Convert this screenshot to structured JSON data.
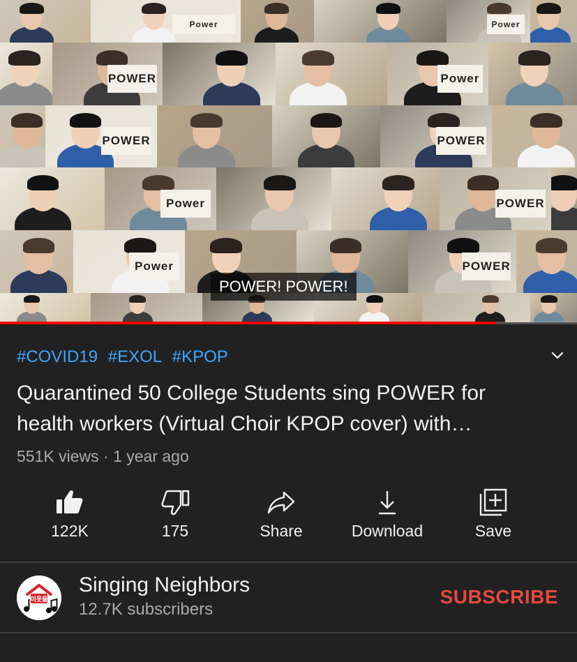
{
  "video": {
    "caption": "POWER! POWER!",
    "progress_percent": 86,
    "tile_signs": [
      "Power",
      "Power",
      "POWER",
      "Power",
      "POWER",
      "POWER",
      "Power",
      "POWER",
      "Power",
      "POWER"
    ]
  },
  "hashtags": [
    "#COVID19",
    "#EXOL",
    "#KPOP"
  ],
  "title": "Quarantined 50 College Students sing POWER for health workers (Virtual Choir KPOP cover) with…",
  "meta": {
    "views": "551K views",
    "separator": " · ",
    "age": "1 year ago"
  },
  "actions": {
    "like": "122K",
    "dislike": "175",
    "share": "Share",
    "download": "Download",
    "save": "Save"
  },
  "channel": {
    "name": "Singing Neighbors",
    "subscribers": "12.7K subscribers",
    "subscribe_label": "SUBSCRIBE",
    "avatar_text": "이웃들"
  },
  "colors": {
    "background": "#212121",
    "hashtag": "#3ea6ff",
    "progress": "#ff0000",
    "subscribe": "#e5493d",
    "secondary_text": "#aaaaaa"
  },
  "icons": [
    "thumb-up-icon",
    "thumb-down-icon",
    "share-icon",
    "download-icon",
    "save-playlist-icon",
    "chevron-down-icon"
  ]
}
